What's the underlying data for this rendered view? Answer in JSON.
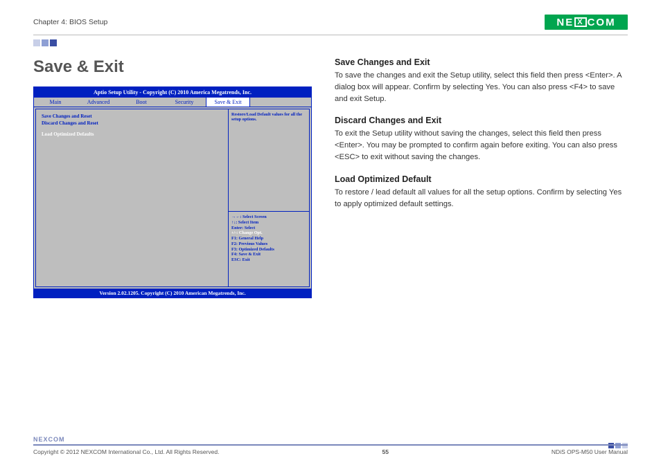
{
  "header": {
    "chapter": "Chapter 4: BIOS Setup",
    "logo_text": "NEXCOM"
  },
  "left": {
    "title": "Save & Exit"
  },
  "bios": {
    "title_bar": "Aptio Setup Utility - Copyright (C) 2010 America Megatrends, Inc.",
    "tabs": [
      "Main",
      "Advanced",
      "Boot",
      "Security",
      "Save & Exit"
    ],
    "selected_tab_index": 4,
    "left_items": [
      {
        "label": "Save Changes and Reset",
        "style": "blue"
      },
      {
        "label": "Discard Changes and Reset",
        "style": "blue"
      },
      {
        "label": "Load Optimized Defaults",
        "style": "white"
      }
    ],
    "right_help": "Restore/Load Default values for all the setup options.",
    "shortcuts": [
      "→←: Select Screen",
      "↑↓: Select Item",
      "Enter: Select",
      "+/-: Change Opt.",
      "F1: General Help",
      "F2: Previous Values",
      "F3: Optimized Defaults",
      "F4: Save & Exit",
      "ESC: Exit"
    ],
    "footer": "Version 2.02.1205. Copyright (C) 2010 American Megatrends, Inc."
  },
  "right": {
    "sections": [
      {
        "heading": "Save Changes and Exit",
        "body": "To save the changes and exit the Setup utility, select this field then press <Enter>. A dialog box will appear. Confirm by selecting Yes. You can also press <F4> to save and exit Setup."
      },
      {
        "heading": "Discard Changes and Exit",
        "body": "To exit the Setup utility without saving the changes, select this field then press <Enter>. You may be prompted to confirm again before exiting. You can also press <ESC> to exit without saving the changes."
      },
      {
        "heading": "Load Optimized Default",
        "body": "To restore / lead default all values for all the setup options. Confirm by selecting Yes to apply optimized default settings."
      }
    ]
  },
  "footer": {
    "logo": "NEXCOM",
    "copyright": "Copyright © 2012 NEXCOM International Co., Ltd. All Rights Reserved.",
    "page": "55",
    "doc": "NDiS OPS-M50 User Manual"
  }
}
